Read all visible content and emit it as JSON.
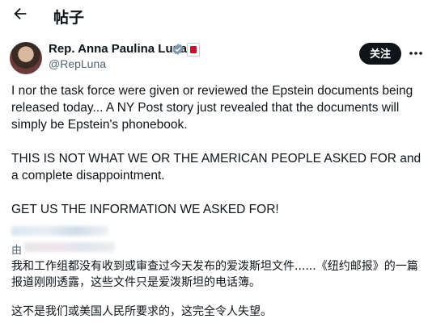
{
  "header": {
    "title": "帖子",
    "back_icon": "arrow-left-icon"
  },
  "author": {
    "name": "Rep. Anna Paulina Luna",
    "handle": "@RepLuna",
    "verified_color": "#829aab",
    "affiliation_color": "#c8102e"
  },
  "actions": {
    "follow_label": "关注",
    "more_icon": "more-dots-icon"
  },
  "tweet": {
    "para1": "I nor the task force were given or reviewed the Epstein documents being released today... A NY Post story just revealed that the documents will simply be Epstein's phonebook.",
    "para2": "THIS IS NOT WHAT WE OR THE AMERICAN PEOPLE ASKED FOR and a complete disappointment.",
    "para3": "GET US THE INFORMATION WE ASKED FOR!"
  },
  "translation": {
    "by_prefix": "由",
    "para1": "我和工作组都没有收到或审查过今天发布的爱泼斯坦文件......《纽约邮报》的一篇报道刚刚透露，这些文件只是爱泼斯坦的电话簿。",
    "para2": "这不是我们或美国人民所要求的，这完全令人失望。"
  }
}
